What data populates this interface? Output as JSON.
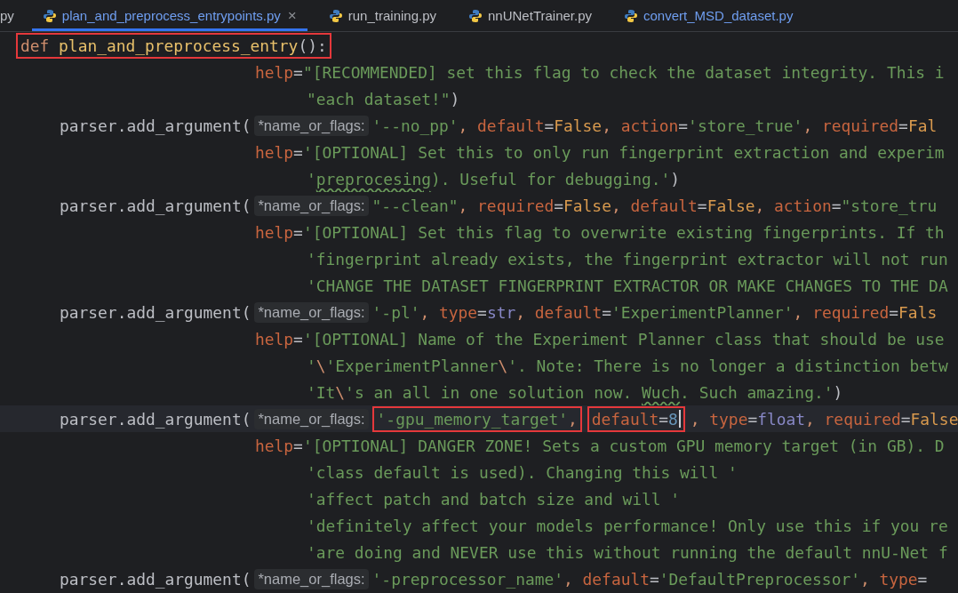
{
  "tabs": [
    {
      "kind": "partial",
      "label": "py",
      "selected": false,
      "color": "#bcbec4"
    },
    {
      "kind": "file",
      "label": "plan_and_preprocess_entrypoints.py",
      "selected": true,
      "color": "#6f9ef0",
      "close": "×"
    },
    {
      "kind": "file",
      "label": "run_training.py",
      "selected": false,
      "color": "#bcbec4"
    },
    {
      "kind": "file",
      "label": "nnUNetTrainer.py",
      "selected": false,
      "color": "#bcbec4"
    },
    {
      "kind": "file",
      "label": "convert_MSD_dataset.py",
      "selected": false,
      "color": "#6f9ef0"
    }
  ],
  "lines": [
    {
      "kind": "def",
      "current": false,
      "segments": [
        {
          "kind": "boxed",
          "caret": false,
          "tokens": [
            {
              "kind": "keyword",
              "text": "def "
            },
            {
              "kind": "func",
              "text": "plan_and_preprocess_entry"
            },
            {
              "kind": "plain",
              "text": "():"
            }
          ]
        }
      ]
    },
    {
      "kind": "help",
      "current": false,
      "segments": [
        {
          "kind": "code",
          "tokens": [
            {
              "kind": "param",
              "text": "help"
            },
            {
              "kind": "plain",
              "text": "="
            },
            {
              "kind": "string",
              "text": "\"[RECOMMENDED] set this flag to check the dataset integrity. This i"
            }
          ]
        }
      ]
    },
    {
      "kind": "cont",
      "current": false,
      "segments": [
        {
          "kind": "code",
          "tokens": [
            {
              "kind": "string",
              "text": "\"each dataset!\""
            },
            {
              "kind": "plain",
              "text": ")"
            }
          ]
        }
      ]
    },
    {
      "kind": "call",
      "current": false,
      "segments": [
        {
          "kind": "code",
          "tokens": [
            {
              "kind": "plain",
              "text": "parser.add_argument("
            }
          ]
        },
        {
          "kind": "hint",
          "text": "*name_or_flags:"
        },
        {
          "kind": "code",
          "tokens": [
            {
              "kind": "string",
              "text": "'--no_pp'"
            },
            {
              "kind": "punct",
              "text": ", "
            },
            {
              "kind": "param",
              "text": "default"
            },
            {
              "kind": "plain",
              "text": "="
            },
            {
              "kind": "literal",
              "text": "False"
            },
            {
              "kind": "punct",
              "text": ", "
            },
            {
              "kind": "param",
              "text": "action"
            },
            {
              "kind": "plain",
              "text": "="
            },
            {
              "kind": "string",
              "text": "'store_true'"
            },
            {
              "kind": "punct",
              "text": ", "
            },
            {
              "kind": "param",
              "text": "required"
            },
            {
              "kind": "plain",
              "text": "="
            },
            {
              "kind": "literal",
              "text": "Fal"
            }
          ]
        }
      ]
    },
    {
      "kind": "help",
      "current": false,
      "segments": [
        {
          "kind": "code",
          "tokens": [
            {
              "kind": "param",
              "text": "help"
            },
            {
              "kind": "plain",
              "text": "="
            },
            {
              "kind": "string",
              "text": "'[OPTIONAL] Set this to only run fingerprint extraction and experim"
            }
          ]
        }
      ]
    },
    {
      "kind": "cont",
      "current": false,
      "segments": [
        {
          "kind": "code",
          "tokens": [
            {
              "kind": "string",
              "text": "'"
            },
            {
              "kind": "misspelled",
              "text": "preprocesing"
            },
            {
              "kind": "string",
              "text": "). Useful for debugging.'"
            },
            {
              "kind": "plain",
              "text": ")"
            }
          ]
        }
      ]
    },
    {
      "kind": "call",
      "current": false,
      "segments": [
        {
          "kind": "code",
          "tokens": [
            {
              "kind": "plain",
              "text": "parser.add_argument("
            }
          ]
        },
        {
          "kind": "hint",
          "text": "*name_or_flags:"
        },
        {
          "kind": "code",
          "tokens": [
            {
              "kind": "string",
              "text": "\"--clean\""
            },
            {
              "kind": "punct",
              "text": ", "
            },
            {
              "kind": "param",
              "text": "required"
            },
            {
              "kind": "plain",
              "text": "="
            },
            {
              "kind": "literal",
              "text": "False"
            },
            {
              "kind": "punct",
              "text": ", "
            },
            {
              "kind": "param",
              "text": "default"
            },
            {
              "kind": "plain",
              "text": "="
            },
            {
              "kind": "literal",
              "text": "False"
            },
            {
              "kind": "punct",
              "text": ", "
            },
            {
              "kind": "param",
              "text": "action"
            },
            {
              "kind": "plain",
              "text": "="
            },
            {
              "kind": "string",
              "text": "\"store_tru"
            }
          ]
        }
      ]
    },
    {
      "kind": "help",
      "current": false,
      "segments": [
        {
          "kind": "code",
          "tokens": [
            {
              "kind": "param",
              "text": "help"
            },
            {
              "kind": "plain",
              "text": "="
            },
            {
              "kind": "string",
              "text": "'[OPTIONAL] Set this flag to overwrite existing fingerprints. If th"
            }
          ]
        }
      ]
    },
    {
      "kind": "cont",
      "current": false,
      "segments": [
        {
          "kind": "code",
          "tokens": [
            {
              "kind": "string",
              "text": "'fingerprint already exists, the fingerprint extractor will not run"
            }
          ]
        }
      ]
    },
    {
      "kind": "cont",
      "current": false,
      "segments": [
        {
          "kind": "code",
          "tokens": [
            {
              "kind": "string",
              "text": "'CHANGE THE DATASET FINGERPRINT EXTRACTOR OR MAKE CHANGES TO THE DA"
            }
          ]
        }
      ]
    },
    {
      "kind": "call",
      "current": false,
      "segments": [
        {
          "kind": "code",
          "tokens": [
            {
              "kind": "plain",
              "text": "parser.add_argument("
            }
          ]
        },
        {
          "kind": "hint",
          "text": "*name_or_flags:"
        },
        {
          "kind": "code",
          "tokens": [
            {
              "kind": "string",
              "text": "'-pl'"
            },
            {
              "kind": "punct",
              "text": ", "
            },
            {
              "kind": "param",
              "text": "type"
            },
            {
              "kind": "plain",
              "text": "="
            },
            {
              "kind": "builtin",
              "text": "str"
            },
            {
              "kind": "punct",
              "text": ", "
            },
            {
              "kind": "param",
              "text": "default"
            },
            {
              "kind": "plain",
              "text": "="
            },
            {
              "kind": "string",
              "text": "'ExperimentPlanner'"
            },
            {
              "kind": "punct",
              "text": ", "
            },
            {
              "kind": "param",
              "text": "required"
            },
            {
              "kind": "plain",
              "text": "="
            },
            {
              "kind": "literal",
              "text": "Fals"
            }
          ]
        }
      ]
    },
    {
      "kind": "help",
      "current": false,
      "segments": [
        {
          "kind": "code",
          "tokens": [
            {
              "kind": "param",
              "text": "help"
            },
            {
              "kind": "plain",
              "text": "="
            },
            {
              "kind": "string",
              "text": "'[OPTIONAL] Name of the Experiment Planner class that should be use"
            }
          ]
        }
      ]
    },
    {
      "kind": "cont",
      "current": false,
      "segments": [
        {
          "kind": "code",
          "tokens": [
            {
              "kind": "string",
              "text": "'"
            },
            {
              "kind": "escape",
              "text": "\\"
            },
            {
              "kind": "string",
              "text": "'ExperimentPlanner"
            },
            {
              "kind": "escape",
              "text": "\\"
            },
            {
              "kind": "string",
              "text": "'. Note: There is no longer a distinction betw"
            }
          ]
        }
      ]
    },
    {
      "kind": "cont",
      "current": false,
      "segments": [
        {
          "kind": "code",
          "tokens": [
            {
              "kind": "string",
              "text": "'It"
            },
            {
              "kind": "escape",
              "text": "\\"
            },
            {
              "kind": "string",
              "text": "'s an all in one solution now. "
            },
            {
              "kind": "misspelled",
              "text": "Wuch"
            },
            {
              "kind": "string",
              "text": ". Such amazing.'"
            },
            {
              "kind": "plain",
              "text": ")"
            }
          ]
        }
      ]
    },
    {
      "kind": "call",
      "current": true,
      "segments": [
        {
          "kind": "code",
          "tokens": [
            {
              "kind": "plain",
              "text": "parser.add_argument("
            }
          ]
        },
        {
          "kind": "hint",
          "text": "*name_or_flags:"
        },
        {
          "kind": "boxed",
          "caret": false,
          "tokens": [
            {
              "kind": "string",
              "text": "'-gpu_memory_target'"
            },
            {
              "kind": "punct",
              "text": ","
            }
          ]
        },
        {
          "kind": "boxed",
          "caret": true,
          "tokens": [
            {
              "kind": "param",
              "text": "default"
            },
            {
              "kind": "plain",
              "text": "="
            },
            {
              "kind": "number",
              "text": "8"
            }
          ]
        },
        {
          "kind": "code",
          "tokens": [
            {
              "kind": "punct",
              "text": ", "
            },
            {
              "kind": "param",
              "text": "type"
            },
            {
              "kind": "plain",
              "text": "="
            },
            {
              "kind": "builtin",
              "text": "float"
            },
            {
              "kind": "punct",
              "text": ", "
            },
            {
              "kind": "param",
              "text": "required"
            },
            {
              "kind": "plain",
              "text": "="
            },
            {
              "kind": "literal",
              "text": "False"
            }
          ]
        }
      ]
    },
    {
      "kind": "help",
      "current": false,
      "segments": [
        {
          "kind": "code",
          "tokens": [
            {
              "kind": "param",
              "text": "help"
            },
            {
              "kind": "plain",
              "text": "="
            },
            {
              "kind": "string",
              "text": "'[OPTIONAL] DANGER ZONE! Sets a custom GPU memory target (in GB). D"
            }
          ]
        }
      ]
    },
    {
      "kind": "cont",
      "current": false,
      "segments": [
        {
          "kind": "code",
          "tokens": [
            {
              "kind": "string",
              "text": "'class default is used). Changing this will '"
            }
          ]
        }
      ]
    },
    {
      "kind": "cont",
      "current": false,
      "segments": [
        {
          "kind": "code",
          "tokens": [
            {
              "kind": "string",
              "text": "'affect patch and batch size and will '"
            }
          ]
        }
      ]
    },
    {
      "kind": "cont",
      "current": false,
      "segments": [
        {
          "kind": "code",
          "tokens": [
            {
              "kind": "string",
              "text": "'definitely affect your models performance! Only use this if you re"
            }
          ]
        }
      ]
    },
    {
      "kind": "cont",
      "current": false,
      "segments": [
        {
          "kind": "code",
          "tokens": [
            {
              "kind": "string",
              "text": "'are doing and NEVER use this without running the default nnU-Net f"
            }
          ]
        }
      ]
    },
    {
      "kind": "call",
      "current": false,
      "segments": [
        {
          "kind": "code",
          "tokens": [
            {
              "kind": "plain",
              "text": "parser.add_argument("
            }
          ]
        },
        {
          "kind": "hint",
          "text": "*name_or_flags:"
        },
        {
          "kind": "code",
          "tokens": [
            {
              "kind": "string",
              "text": "'-preprocessor_name'"
            },
            {
              "kind": "punct",
              "text": ", "
            },
            {
              "kind": "param",
              "text": "default"
            },
            {
              "kind": "plain",
              "text": "="
            },
            {
              "kind": "string",
              "text": "'DefaultPreprocessor'"
            },
            {
              "kind": "punct",
              "text": ", "
            },
            {
              "kind": "param",
              "text": "type"
            },
            {
              "kind": "plain",
              "text": "="
            }
          ]
        }
      ]
    }
  ]
}
